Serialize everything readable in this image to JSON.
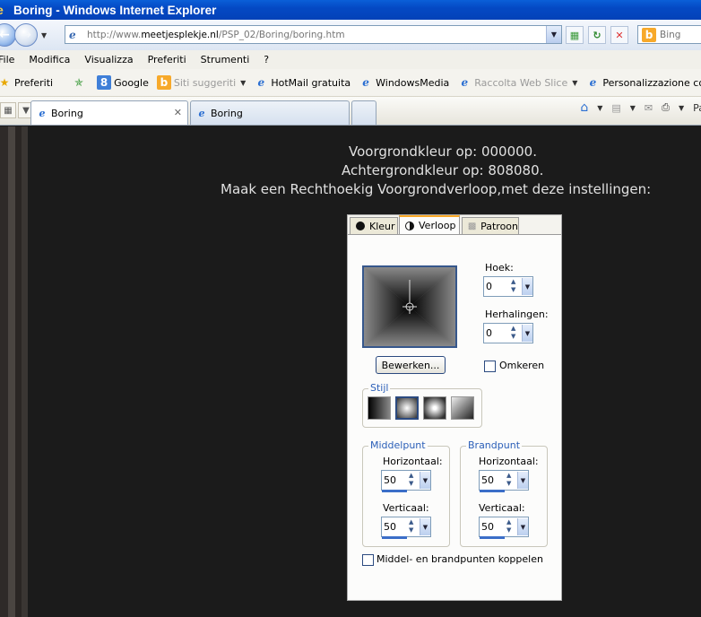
{
  "window": {
    "title": "Boring - Windows Internet Explorer"
  },
  "address": {
    "url_prefix": "http://www.",
    "url_domain": "meetjesplekje.nl",
    "url_path": "/PSP_02/Boring/boring.htm"
  },
  "search": {
    "placeholder": "Bing"
  },
  "menu": {
    "items": [
      "File",
      "Modifica",
      "Visualizza",
      "Preferiti",
      "Strumenti",
      "?"
    ]
  },
  "favorites": {
    "label": "Preferiti",
    "items": [
      "Google",
      "Siti suggeriti",
      "HotMail gratuita",
      "WindowsMedia",
      "Raccolta Web Slice",
      "Personalizzazione collegamenti"
    ]
  },
  "tabs": [
    {
      "label": "Boring"
    },
    {
      "label": "Boring"
    }
  ],
  "cmdbar": {
    "page_label": "Pa"
  },
  "content": {
    "line1": "Voorgrondkleur op: 000000.",
    "line2": "Achtergrondkleur op: 808080.",
    "line3": "Maak een Rechthoekig Voorgrondverloop,met deze instellingen:"
  },
  "dialog": {
    "tabs": {
      "kleur": "Kleur",
      "verloop": "Verloop",
      "patroon": "Patroon"
    },
    "hoek_label": "Hoek:",
    "hoek_value": "0",
    "herhalingen_label": "Herhalingen:",
    "herhalingen_value": "0",
    "bewerken_label": "Bewerken...",
    "omkeren_label": "Omkeren",
    "stijl_label": "Stijl",
    "middelpunt_label": "Middelpunt",
    "brandpunt_label": "Brandpunt",
    "horizontaal_label": "Horizontaal:",
    "verticaal_label": "Verticaal:",
    "mid_h": "50",
    "mid_v": "50",
    "brand_h": "50",
    "brand_v": "50",
    "koppelen_label": "Middel- en brandpunten koppelen"
  }
}
